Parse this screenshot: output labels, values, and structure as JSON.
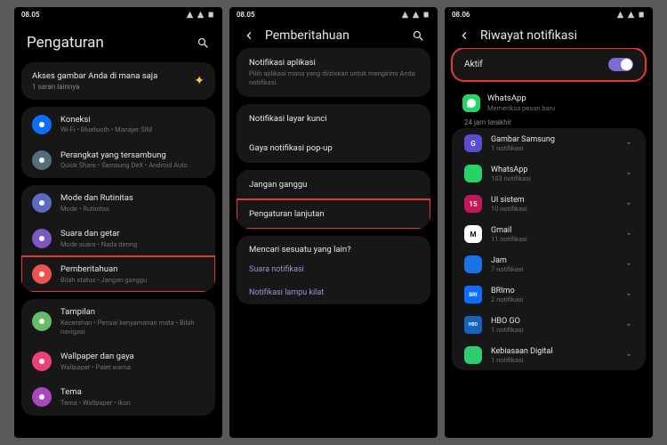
{
  "statusbar": {
    "time1": "08.05",
    "time2": "08.05",
    "time3": "08.06"
  },
  "p1": {
    "title": "Pengaturan",
    "suggest": {
      "title": "Akses gambar Anda di mana saja",
      "sub": "1 saran lainnya"
    },
    "g1": [
      {
        "name": "koneksi",
        "color": "#0d6efd",
        "title": "Koneksi",
        "sub": "Wi-Fi • Bluetooth • Manajer SIM"
      },
      {
        "name": "perangkat",
        "color": "#546e7a",
        "title": "Perangkat yang tersambung",
        "sub": "Quick Share • Samsung DeX • Android Auto"
      }
    ],
    "g2": [
      {
        "name": "mode",
        "color": "#5c6bc0",
        "title": "Mode dan Rutinitas",
        "sub": "Mode • Rutinitas"
      },
      {
        "name": "suara",
        "color": "#7e57c2",
        "title": "Suara dan getar",
        "sub": "Mode suara • Nada dering"
      },
      {
        "name": "pemberitahuan",
        "color": "#ef5350",
        "title": "Pemberitahuan",
        "sub": "Bilah status • Jangan ganggu"
      }
    ],
    "g3": [
      {
        "name": "tampilan",
        "color": "#66bb6a",
        "title": "Tampilan",
        "sub": "Kecerahan • Perisai kenyamanan mata • Bilah navigasi"
      },
      {
        "name": "wallpaper",
        "color": "#ec407a",
        "title": "Wallpaper dan gaya",
        "sub": "Wallpaper • Palet warna"
      },
      {
        "name": "tema",
        "color": "#ab47bc",
        "title": "Tema",
        "sub": "Tema • Wallpaper • Ikon"
      }
    ]
  },
  "p2": {
    "title": "Pemberitahuan",
    "g1": {
      "title": "Notifikasi aplikasi",
      "sub": "Pilih aplikasi mana yang diizinkan untuk mengirimi Anda notifikasi."
    },
    "g2": [
      "Notifikasi layar kunci",
      "Gaya notifikasi pop-up"
    ],
    "g3": [
      "Jangan ganggu",
      "Pengaturan lanjutan"
    ],
    "g4": {
      "label": "Mencari sesuatu yang lain?",
      "links": [
        "Suara notifikasi",
        "Notifikasi lampu kilat"
      ]
    }
  },
  "p3": {
    "title": "Riwayat notifikasi",
    "active": "Aktif",
    "app": {
      "name": "WhatsApp",
      "status": "Memeriksa pesan baru"
    },
    "section": "24 jam terakhir",
    "list": [
      {
        "cls": "sg",
        "abbr": "G",
        "name": "Gambar Samsung",
        "sub": "1 notifikasi"
      },
      {
        "cls": "wa",
        "abbr": "",
        "name": "WhatsApp",
        "sub": "103 notifikasi"
      },
      {
        "cls": "ui",
        "abbr": "15",
        "name": "UI sistem",
        "sub": "10 notifikasi"
      },
      {
        "cls": "gm",
        "abbr": "M",
        "name": "Gmail",
        "sub": "11 notifikasi"
      },
      {
        "cls": "cl",
        "abbr": "",
        "name": "Jam",
        "sub": "7 notifikasi"
      },
      {
        "cls": "br",
        "abbr": "BRI",
        "name": "BRImo",
        "sub": "2 notifikasi"
      },
      {
        "cls": "hb",
        "abbr": "HBO",
        "name": "HBO GO",
        "sub": "1 notifikasi"
      },
      {
        "cls": "dg",
        "abbr": "",
        "name": "Kebiasaan Digital",
        "sub": "1 notifikasi"
      }
    ]
  }
}
